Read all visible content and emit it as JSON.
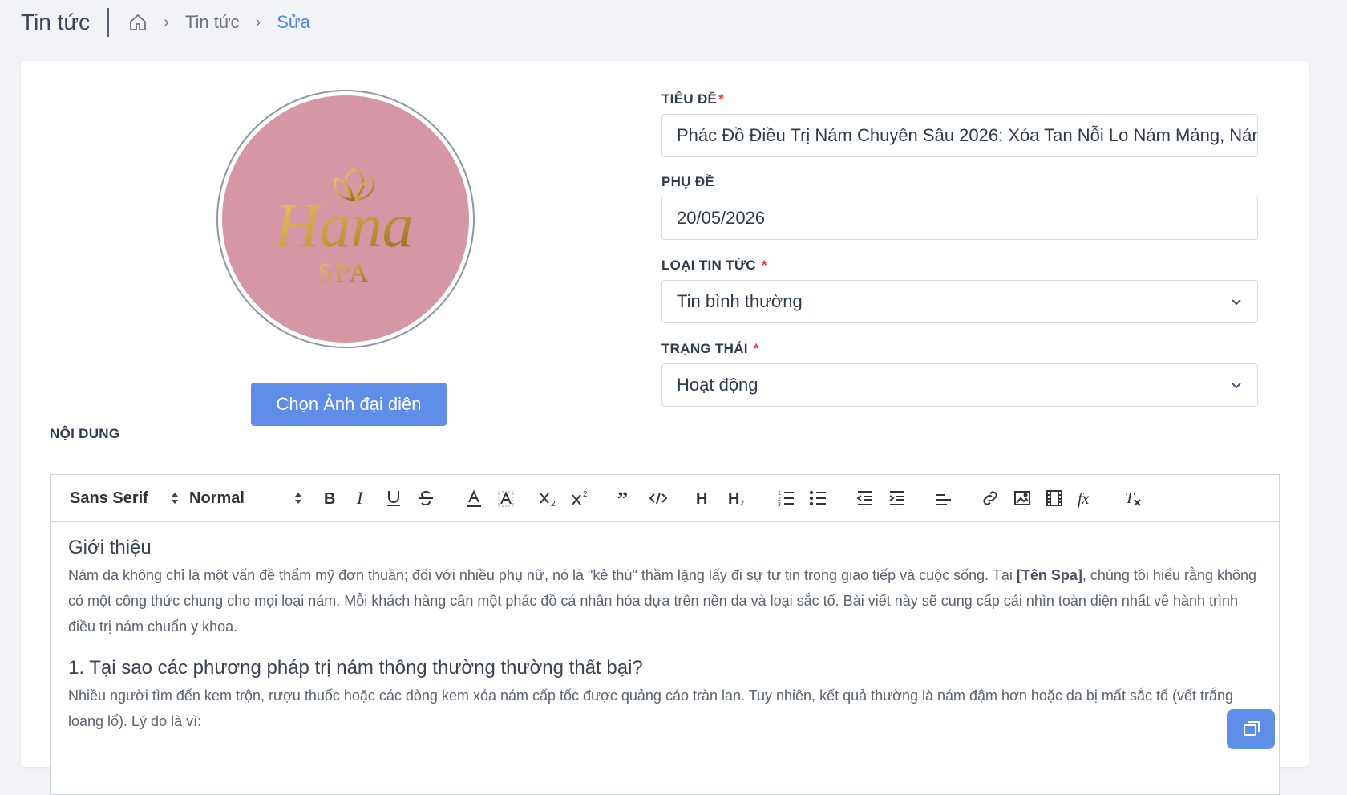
{
  "header": {
    "title": "Tin tức",
    "breadcrumb": [
      "Tin tức",
      "Sửa"
    ]
  },
  "avatar": {
    "logo_main": "Hana",
    "logo_sub": "SPA",
    "button_label": "Chọn Ảnh đại diện"
  },
  "form": {
    "title_label": "TIÊU ĐỀ",
    "title_value": "Phác Đồ Điều Trị Nám Chuyên Sâu 2026: Xóa Tan Nỗi Lo Nám Mảng, Nám",
    "subtitle_label": "PHỤ ĐỀ",
    "subtitle_value": "20/05/2026",
    "type_label": "LOẠI TIN TỨC",
    "type_value": "Tin bình thường",
    "status_label": "TRẠNG THÁI",
    "status_value": "Hoạt động",
    "required_mark": "*"
  },
  "editor": {
    "label": "NỘI DUNG",
    "font_picker": "Sans Serif",
    "size_picker": "Normal",
    "content": {
      "intro_heading": "Giới thiệu",
      "intro_p1": "Nám da không chỉ là một vấn đề thẩm mỹ đơn thuần; đối với nhiều phụ nữ, nó là \"kẻ thù\" thầm lặng lấy đi sự tự tin trong giao tiếp và cuộc sống. Tại ",
      "intro_bold": "[Tên Spa]",
      "intro_p2": ", chúng tôi hiểu rằng không có một công thức chung cho mọi loại nám. Mỗi khách hàng cần một phác đồ cá nhân hóa dựa trên nền da và loại sắc tố. Bài viết này sẽ cung cấp cái nhìn toàn diện nhất về hành trình điều trị nám chuẩn y khoa.",
      "section1_heading": "1. Tại sao các phương pháp trị nám thông thường thường thất bại?",
      "section1_p": "Nhiều người tìm đến kem trộn, rượu thuốc hoặc các dòng kem xóa nám cấp tốc được quảng cáo tràn lan. Tuy nhiên, kết quả thường là nám đậm hơn hoặc da bị mất sắc tố (vết trắng loang lổ). Lý do là vì:"
    }
  },
  "colors": {
    "accent": "#5e8ee8",
    "required": "#e53e3e",
    "avatar_bg": "#d597a5",
    "logo_gold": "#c9a043"
  }
}
